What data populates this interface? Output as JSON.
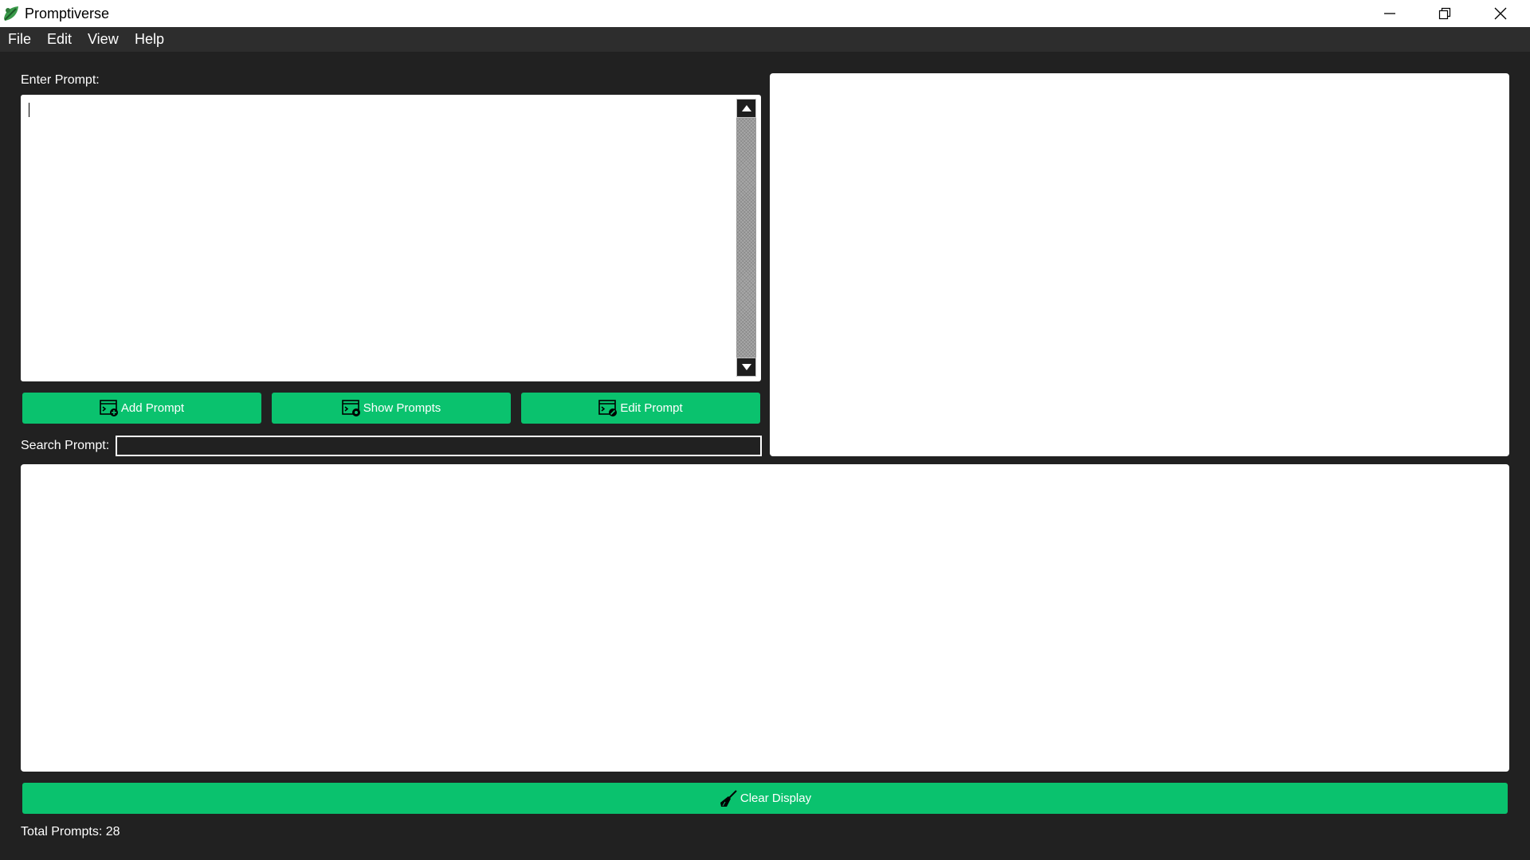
{
  "window": {
    "title": "Promptiverse",
    "controls": [
      "minimize-icon",
      "restore-icon",
      "close-icon"
    ]
  },
  "menu": {
    "items": [
      "File",
      "Edit",
      "View",
      "Help"
    ]
  },
  "prompt_entry": {
    "label": "Enter Prompt:",
    "value": ""
  },
  "actions": {
    "add": {
      "label": "Add Prompt",
      "icon": "terminal-add-icon"
    },
    "show": {
      "label": "Show Prompts",
      "icon": "terminal-view-icon"
    },
    "edit": {
      "label": "Edit Prompt",
      "icon": "terminal-edit-icon"
    }
  },
  "search": {
    "label": "Search Prompt:",
    "value": ""
  },
  "clear": {
    "label": "Clear Display",
    "icon": "broom-icon"
  },
  "status": {
    "total": "Total Prompts: 28"
  },
  "colors": {
    "background": "#212121",
    "menubar": "#2d2d2d",
    "accent": "#0ac26e",
    "panel": "#ffffff"
  }
}
